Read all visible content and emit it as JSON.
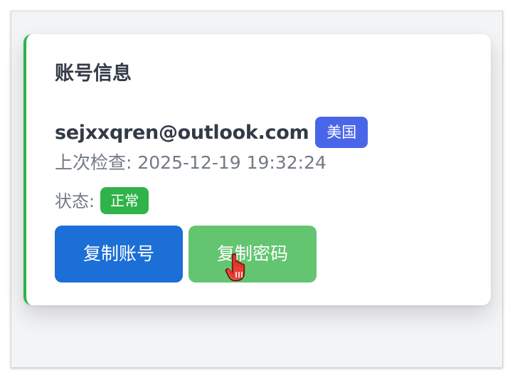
{
  "card": {
    "title": "账号信息",
    "email": "sejxxqren@outlook.com",
    "region_badge": "美国",
    "last_check": "上次检查: 2025-12-19 19:32:24",
    "status_label": "状态:",
    "status_badge": "正常"
  },
  "actions": {
    "copy_account_label": "复制账号",
    "copy_password_label": "复制密码"
  },
  "colors": {
    "accent_border": "#2fb34a",
    "region_badge": "#4a66e8",
    "status_badge": "#2fb34a",
    "copy_account_button": "#1b6fd6",
    "copy_password_button": "#64c571"
  },
  "icons": {
    "cursor": "hand-pointer-icon"
  }
}
